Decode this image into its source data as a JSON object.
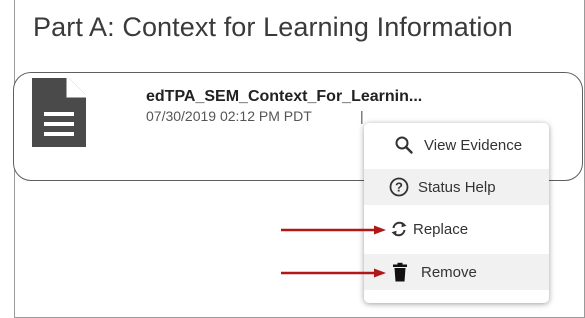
{
  "section": {
    "title": "Part A: Context for Learning Information"
  },
  "file": {
    "name": "edTPA_SEM_Context_For_Learnin...",
    "meta": "07/30/2019 02:12 PM PDT",
    "meta_separator": "|",
    "icon": "document-icon"
  },
  "menu": {
    "items": [
      {
        "label": "View Evidence",
        "icon": "search-icon"
      },
      {
        "label": "Status Help",
        "icon": "question-circle-icon"
      },
      {
        "label": "Replace",
        "icon": "replace-arrows-icon"
      },
      {
        "label": "Remove",
        "icon": "trash-icon"
      }
    ]
  },
  "colors": {
    "arrow": "#b01818",
    "icon": "#4a4a4a",
    "highlight": "#f1f1f1"
  }
}
